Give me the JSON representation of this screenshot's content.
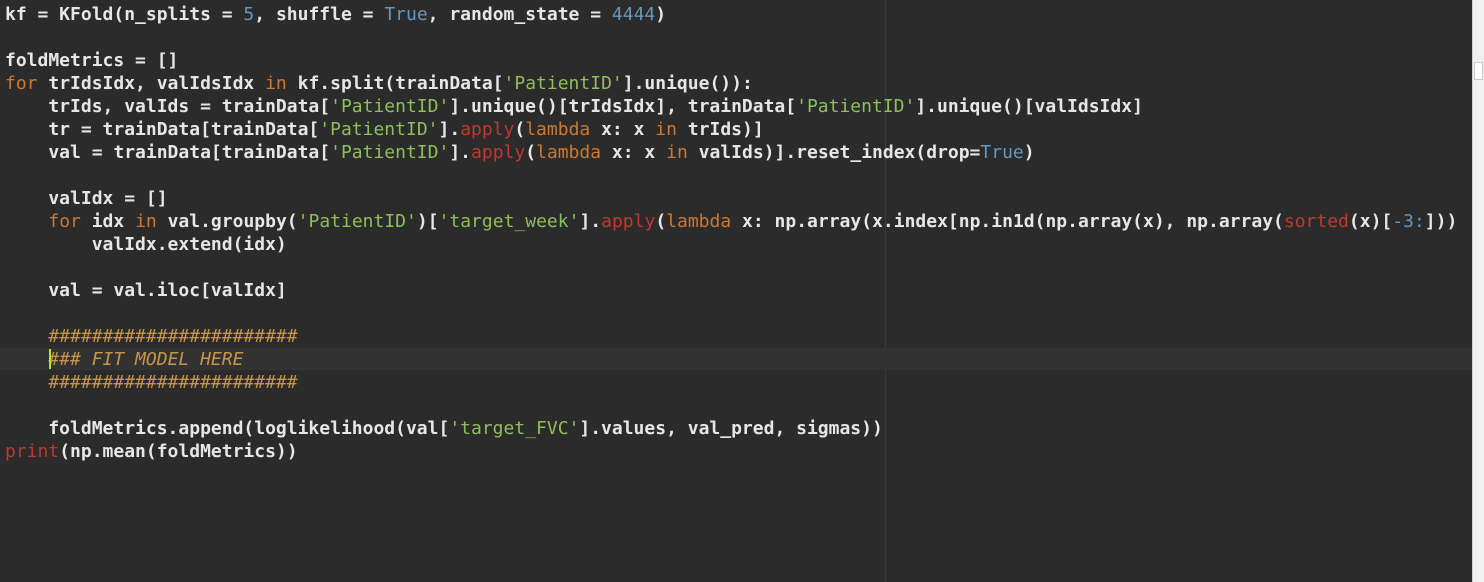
{
  "colors": {
    "background": "#2b2b2b",
    "plain": "#e6e6e6",
    "keyword": "#cc7832",
    "number": "#6897bb",
    "string": "#8fbf5a",
    "builtin": "#c0392b",
    "comment": "#c6954a",
    "cursor": "#b5e61d"
  },
  "editor": {
    "language": "python",
    "lines": [
      {
        "tokens": [
          {
            "t": "plain",
            "v": "kf = KFold(n_splits = "
          },
          {
            "t": "number",
            "v": "5"
          },
          {
            "t": "plain",
            "v": ", shuffle = "
          },
          {
            "t": "const",
            "v": "True"
          },
          {
            "t": "plain",
            "v": ", random_state = "
          },
          {
            "t": "number",
            "v": "4444"
          },
          {
            "t": "plain",
            "v": ")"
          }
        ]
      },
      {
        "tokens": []
      },
      {
        "tokens": [
          {
            "t": "plain",
            "v": "foldMetrics = []"
          }
        ]
      },
      {
        "tokens": [
          {
            "t": "keyword",
            "v": "for"
          },
          {
            "t": "plain",
            "v": " trIdsIdx, valIdsIdx "
          },
          {
            "t": "keyword",
            "v": "in"
          },
          {
            "t": "plain",
            "v": " kf.split(trainData["
          },
          {
            "t": "string",
            "v": "'PatientID'"
          },
          {
            "t": "plain",
            "v": "].unique()):"
          }
        ]
      },
      {
        "tokens": [
          {
            "t": "plain",
            "v": "    trIds, valIds = trainData["
          },
          {
            "t": "string",
            "v": "'PatientID'"
          },
          {
            "t": "plain",
            "v": "].unique()[trIdsIdx], trainData["
          },
          {
            "t": "string",
            "v": "'PatientID'"
          },
          {
            "t": "plain",
            "v": "].unique()[valIdsIdx]"
          }
        ]
      },
      {
        "tokens": [
          {
            "t": "plain",
            "v": "    tr = trainData[trainData["
          },
          {
            "t": "string",
            "v": "'PatientID'"
          },
          {
            "t": "plain",
            "v": "]."
          },
          {
            "t": "builtin",
            "v": "apply"
          },
          {
            "t": "plain",
            "v": "("
          },
          {
            "t": "keyword",
            "v": "lambda"
          },
          {
            "t": "plain",
            "v": " x: x "
          },
          {
            "t": "keyword",
            "v": "in"
          },
          {
            "t": "plain",
            "v": " trIds)]"
          }
        ]
      },
      {
        "tokens": [
          {
            "t": "plain",
            "v": "    val = trainData[trainData["
          },
          {
            "t": "string",
            "v": "'PatientID'"
          },
          {
            "t": "plain",
            "v": "]."
          },
          {
            "t": "builtin",
            "v": "apply"
          },
          {
            "t": "plain",
            "v": "("
          },
          {
            "t": "keyword",
            "v": "lambda"
          },
          {
            "t": "plain",
            "v": " x: x "
          },
          {
            "t": "keyword",
            "v": "in"
          },
          {
            "t": "plain",
            "v": " valIds)].reset_index(drop="
          },
          {
            "t": "const",
            "v": "True"
          },
          {
            "t": "plain",
            "v": ")"
          }
        ]
      },
      {
        "tokens": []
      },
      {
        "tokens": [
          {
            "t": "plain",
            "v": "    valIdx = []"
          }
        ]
      },
      {
        "tokens": [
          {
            "t": "plain",
            "v": "    "
          },
          {
            "t": "keyword",
            "v": "for"
          },
          {
            "t": "plain",
            "v": " idx "
          },
          {
            "t": "keyword",
            "v": "in"
          },
          {
            "t": "plain",
            "v": " val.groupby("
          },
          {
            "t": "string",
            "v": "'PatientID'"
          },
          {
            "t": "plain",
            "v": ")["
          },
          {
            "t": "string",
            "v": "'target_week'"
          },
          {
            "t": "plain",
            "v": "]."
          },
          {
            "t": "builtin",
            "v": "apply"
          },
          {
            "t": "plain",
            "v": "("
          },
          {
            "t": "keyword",
            "v": "lambda"
          },
          {
            "t": "plain",
            "v": " x: np.array(x.index[np.in1d(np.array(x), np.array("
          },
          {
            "t": "builtin",
            "v": "sorted"
          },
          {
            "t": "plain",
            "v": "(x)["
          },
          {
            "t": "number",
            "v": "-3:"
          },
          {
            "t": "plain",
            "v": "]))"
          }
        ]
      },
      {
        "tokens": [
          {
            "t": "plain",
            "v": "        valIdx.extend(idx)"
          }
        ]
      },
      {
        "tokens": []
      },
      {
        "tokens": [
          {
            "t": "plain",
            "v": "    val = val.iloc[valIdx]"
          }
        ]
      },
      {
        "tokens": []
      },
      {
        "tokens": [
          {
            "t": "plain",
            "v": "    "
          },
          {
            "t": "hash",
            "v": "#######################"
          }
        ]
      },
      {
        "tokens": [
          {
            "t": "plain",
            "v": "    "
          },
          {
            "t": "comment",
            "v": "### FIT MODEL HERE"
          }
        ]
      },
      {
        "tokens": [
          {
            "t": "plain",
            "v": "    "
          },
          {
            "t": "hash",
            "v": "#######################"
          }
        ]
      },
      {
        "tokens": []
      },
      {
        "tokens": [
          {
            "t": "plain",
            "v": "    foldMetrics.append(loglikelihood(val["
          },
          {
            "t": "string",
            "v": "'target_FVC'"
          },
          {
            "t": "plain",
            "v": "].values, val_pred, sigmas))"
          }
        ]
      },
      {
        "tokens": [
          {
            "t": "builtin",
            "v": "print"
          },
          {
            "t": "plain",
            "v": "(np.mean(foldMetrics))"
          }
        ]
      }
    ]
  }
}
